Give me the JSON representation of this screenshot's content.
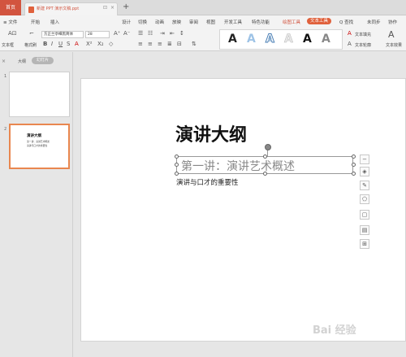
{
  "titlebar": {
    "home_tab": "首页",
    "doc_title": "新建 PPT 演示文稿.ppt",
    "tab_add": "+",
    "tab_close": "×",
    "tab_monitor": "⊡"
  },
  "menubar": {
    "file": "≡ 文件",
    "items": [
      "开始",
      "插入",
      "设计",
      "切换",
      "动画",
      "放映",
      "审阅",
      "视图",
      "开发工具",
      "特色功能",
      "绘图工具"
    ],
    "highlight": "文本工具",
    "search": "Q 查找",
    "right_items": [
      "未同步",
      "协作"
    ]
  },
  "toolbar": {
    "textbox_label": "文本框",
    "format_label": "格式刷",
    "font_name": "方正兰亭细黑简体",
    "font_size": "28",
    "style_letter": "A",
    "text_fill": "文本填充",
    "text_outline": "文本轮廓",
    "text_effect": "文本效果"
  },
  "left_panel": {
    "close": "×",
    "outline_tab": "大纲",
    "slides_tab": "幻灯片",
    "slides": [
      {
        "num": "1",
        "title": "",
        "lines": []
      },
      {
        "num": "2",
        "title": "演讲大纲",
        "lines": [
          "第一讲：演讲艺术概述",
          "演讲与口才的重要性"
        ]
      }
    ]
  },
  "slide": {
    "title": "演讲大纲",
    "subtitle": "第一讲：演讲艺术概述",
    "body": "演讲与口才的重要性"
  },
  "float_tools": [
    "−",
    "◈",
    "✎",
    "⬠",
    "▢",
    "▤",
    "⊞"
  ],
  "watermark": "Bai 经验"
}
